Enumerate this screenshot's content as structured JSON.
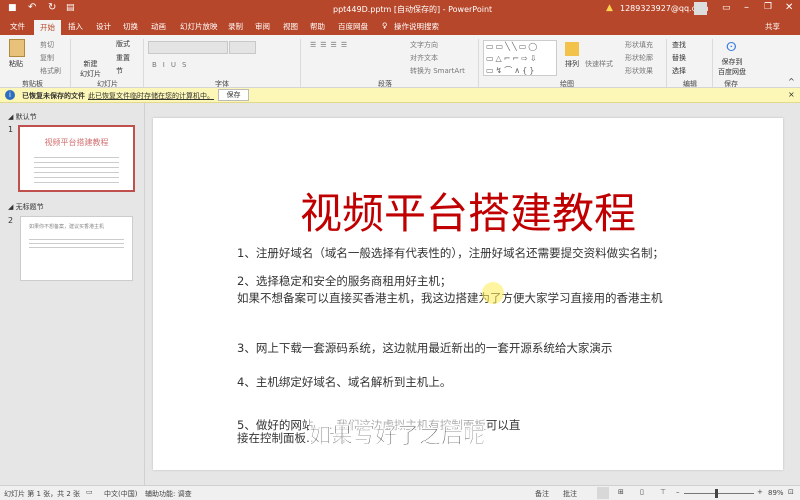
{
  "titlebar": {
    "title": "ppt449D.pptm [自动保存的] - PowerPoint",
    "account": "1289323927@qq.com",
    "qat": [
      "save-icon",
      "undo-icon",
      "redo-icon",
      "start-from-beginning-icon"
    ]
  },
  "tabs": [
    {
      "label": "文件"
    },
    {
      "label": "开始",
      "active": true
    },
    {
      "label": "插入"
    },
    {
      "label": "设计"
    },
    {
      "label": "切换"
    },
    {
      "label": "动画"
    },
    {
      "label": "幻灯片放映"
    },
    {
      "label": "录制"
    },
    {
      "label": "审阅"
    },
    {
      "label": "视图"
    },
    {
      "label": "帮助"
    },
    {
      "label": "百度网盘"
    },
    {
      "label": "操作说明搜索"
    }
  ],
  "share": "共享",
  "ribbon": {
    "clipboard": {
      "paste": "粘贴",
      "cut": "剪切",
      "copy": "复制",
      "format": "格式刷",
      "group": "剪贴板"
    },
    "slides": {
      "new": "新建\n幻灯片",
      "layout": "版式",
      "reset": "重置",
      "section": "节",
      "group": "幻灯片"
    },
    "font": {
      "group": "字体"
    },
    "paragraph": {
      "text_dir": "文字方向",
      "align": "对齐文本",
      "smartart": "转换为 SmartArt",
      "group": "段落"
    },
    "drawing": {
      "arrange": "排列",
      "quick": "快速样式",
      "fill": "形状填充",
      "outline": "形状轮廓",
      "effect": "形状效果",
      "group": "绘图"
    },
    "editing": {
      "find": "查找",
      "replace": "替换",
      "select": "选择",
      "group": "编辑"
    },
    "save": {
      "label": "保存到\n百度网盘",
      "group": "保存"
    }
  },
  "infobar": {
    "title": "已恢复未保存的文件",
    "message": "此已恢复文件临时存储在您的计算机中。",
    "button": "保存"
  },
  "sections": [
    {
      "name": "默认节",
      "slide": "1"
    },
    {
      "name": "无标题节",
      "slide": "2"
    }
  ],
  "thumb1_title": "视频平台搭建教程",
  "thumb2_title": "如果你不想备案，建议买香港主机",
  "slide": {
    "title": "视频平台搭建教程",
    "lines": [
      "1、注册好域名（域名一般选择有代表性的），注册好域名还需要提交资料做实名制；",
      "2、选择稳定和安全的服务商租用好主机；",
      "如果不想备案可以直接买香港主机，我这边搭建为了方便大家学习直接用的香港主机",
      "3、网上下载一套源码系统，这边就用最近新出的一套开源系统给大家演示",
      "4、主机绑定好域名、域名解析到主机上。",
      "5、做好的网站……我们这边虚拟主机有控制面板可以直",
      "接在控制面板……了；"
    ],
    "subtitle": "如果写好了之后呢"
  },
  "status": {
    "slide_info": "幻灯片 第 1 张，共 2 张",
    "language": "中文(中国)",
    "accessibility": "辅助功能: 调查",
    "notes": "备注",
    "comments": "批注",
    "zoom": "89%",
    "zoom_value": 89
  },
  "colors": {
    "accent": "#b7472a",
    "title_red": "#c00000",
    "infobar": "#fcf7b6"
  }
}
